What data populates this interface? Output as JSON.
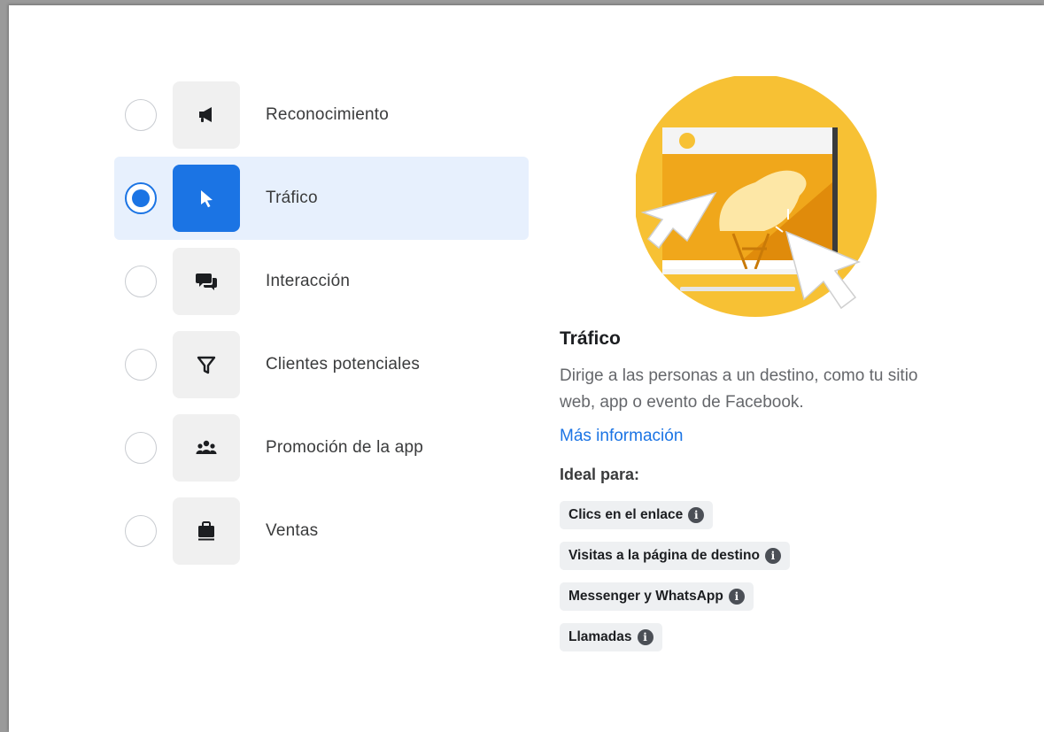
{
  "objectives": [
    {
      "label": "Reconocimiento",
      "icon": "megaphone-icon",
      "selected": false
    },
    {
      "label": "Tráfico",
      "icon": "cursor-icon",
      "selected": true
    },
    {
      "label": "Interacción",
      "icon": "chat-bubbles-icon",
      "selected": false
    },
    {
      "label": "Clientes potenciales",
      "icon": "funnel-icon",
      "selected": false
    },
    {
      "label": "Promoción de la app",
      "icon": "people-icon",
      "selected": false
    },
    {
      "label": "Ventas",
      "icon": "briefcase-icon",
      "selected": false
    }
  ],
  "detail": {
    "title": "Tráfico",
    "description": "Dirige a las personas a un destino, como tu sitio web, app o evento de Facebook.",
    "link": "Más información",
    "ideal_label": "Ideal para:",
    "chips": [
      "Clics en el enlace",
      "Visitas a la página de destino",
      "Messenger y WhatsApp",
      "Llamadas"
    ]
  },
  "colors": {
    "accent": "#1b74e4",
    "selected_row_bg": "#e7f0fd",
    "illustration_yellow": "#f7c134"
  }
}
